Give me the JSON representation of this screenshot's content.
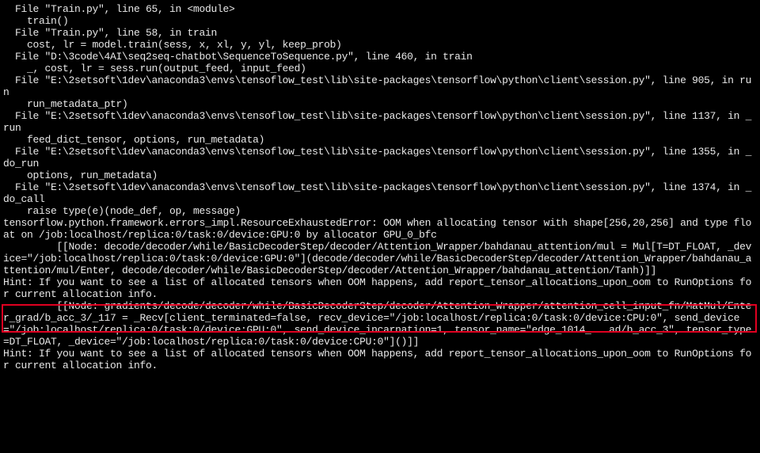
{
  "lines": {
    "l1": "  File \"Train.py\", line 65, in <module>",
    "l2": "    train()",
    "l3": "  File \"Train.py\", line 58, in train",
    "l4": "    cost, lr = model.train(sess, x, xl, y, yl, keep_prob)",
    "l5": "  File \"D:\\3code\\4AI\\seq2seq-chatbot\\SequenceToSequence.py\", line 460, in train",
    "l6": "    _, cost, lr = sess.run(output_feed, input_feed)",
    "l7": "  File \"E:\\2setsoft\\1dev\\anaconda3\\envs\\tensoflow_test\\lib\\site-packages\\tensorflow\\python\\client\\session.py\", line 905, in run",
    "l8": "    run_metadata_ptr)",
    "l9": "  File \"E:\\2setsoft\\1dev\\anaconda3\\envs\\tensoflow_test\\lib\\site-packages\\tensorflow\\python\\client\\session.py\", line 1137, in _run",
    "l10": "    feed_dict_tensor, options, run_metadata)",
    "l11": "  File \"E:\\2setsoft\\1dev\\anaconda3\\envs\\tensoflow_test\\lib\\site-packages\\tensorflow\\python\\client\\session.py\", line 1355, in _do_run",
    "l12": "    options, run_metadata)",
    "l13": "  File \"E:\\2setsoft\\1dev\\anaconda3\\envs\\tensoflow_test\\lib\\site-packages\\tensorflow\\python\\client\\session.py\", line 1374, in _do_call",
    "l14": "    raise type(e)(node_def, op, message)",
    "l15": "tensorflow.python.framework.errors_impl.ResourceExhaustedError: OOM when allocating tensor with shape[256,20,256] and type float on /job:localhost/replica:0/task:0/device:GPU:0 by allocator GPU_0_bfc",
    "l16": "         [[Node: decode/decoder/while/BasicDecoderStep/decoder/Attention_Wrapper/bahdanau_attention/mul = Mul[T=DT_FLOAT, _device=\"/job:localhost/replica:0/task:0/device:GPU:0\"](decode/decoder/while/BasicDecoderStep/decoder/Attention_Wrapper/bahdanau_attention/mul/Enter, decode/decoder/while/BasicDecoderStep/decoder/Attention_Wrapper/bahdanau_attention/Tanh)]]",
    "l17": "Hint: If you want to see a list of allocated tensors when OOM happens, add report_tensor_allocations_upon_oom to RunOptions for current allocation info.",
    "l18": "",
    "l19": "         [[Node: gradients/decode/decoder/while/BasicDecoderStep/decoder/Attention_Wrapper/attention_cell_input_fn/MatMul/Enter_grad/b_acc_3/_117 = _Recv[client_terminated=false, recv_device=\"/job:localhost/replica:0/task:0/device:CPU:0\", send_device=\"/job:localhost/replica:0/task:0/device:GPU:0\", send_device_incarnation=1, tensor_name=\"edge_1014_...ad/b_acc_3\", tensor_type=DT_FLOAT, _device=\"/job:localhost/replica:0/task:0/device:CPU:0\"]()]]",
    "l20": "Hint: If you want to see a list of allocated tensors when OOM happens, add report_tensor_allocations_upon_oom to RunOptions for current allocation info."
  }
}
